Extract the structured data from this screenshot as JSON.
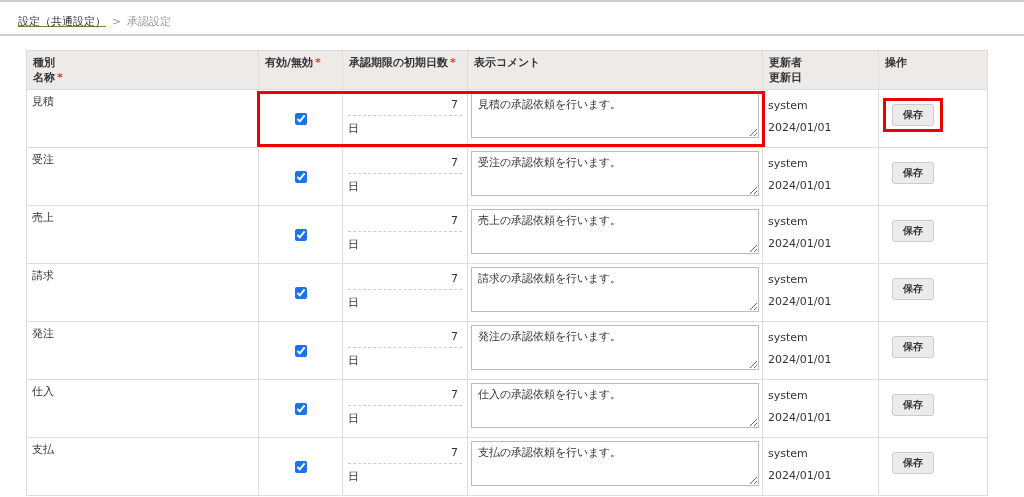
{
  "breadcrumb": {
    "link": "設定（共通設定）",
    "separator": ">",
    "current": "承認設定"
  },
  "table": {
    "columns": [
      {
        "lines": [
          "種別",
          "名称"
        ],
        "required_mark": "*"
      },
      {
        "lines": [
          "有効/無効"
        ],
        "required_mark": "*"
      },
      {
        "lines": [
          "承認期限の初期日数"
        ],
        "required_mark": "*"
      },
      {
        "lines": [
          "表示コメント"
        ]
      },
      {
        "lines": [
          "更新者",
          "更新日"
        ]
      },
      {
        "lines": [
          "操作"
        ]
      }
    ],
    "rows": [
      {
        "name": "見積",
        "checked": true,
        "days": "7",
        "unit": "日",
        "comment": "見積の承認依頼を行います。",
        "updater": "system",
        "updated": "2024/01/01",
        "button": "保存",
        "highlighted": true
      },
      {
        "name": "受注",
        "checked": true,
        "days": "7",
        "unit": "日",
        "comment": "受注の承認依頼を行います。",
        "updater": "system",
        "updated": "2024/01/01",
        "button": "保存",
        "highlighted": false
      },
      {
        "name": "売上",
        "checked": true,
        "days": "7",
        "unit": "日",
        "comment": "売上の承認依頼を行います。",
        "updater": "system",
        "updated": "2024/01/01",
        "button": "保存",
        "highlighted": false
      },
      {
        "name": "請求",
        "checked": true,
        "days": "7",
        "unit": "日",
        "comment": "請求の承認依頼を行います。",
        "updater": "system",
        "updated": "2024/01/01",
        "button": "保存",
        "highlighted": false
      },
      {
        "name": "発注",
        "checked": true,
        "days": "7",
        "unit": "日",
        "comment": "発注の承認依頼を行います。",
        "updater": "system",
        "updated": "2024/01/01",
        "button": "保存",
        "highlighted": false
      },
      {
        "name": "仕入",
        "checked": true,
        "days": "7",
        "unit": "日",
        "comment": "仕入の承認依頼を行います。",
        "updater": "system",
        "updated": "2024/01/01",
        "button": "保存",
        "highlighted": false
      },
      {
        "name": "支払",
        "checked": true,
        "days": "7",
        "unit": "日",
        "comment": "支払の承認依頼を行います。",
        "updater": "system",
        "updated": "2024/01/01",
        "button": "保存",
        "highlighted": false
      }
    ]
  }
}
